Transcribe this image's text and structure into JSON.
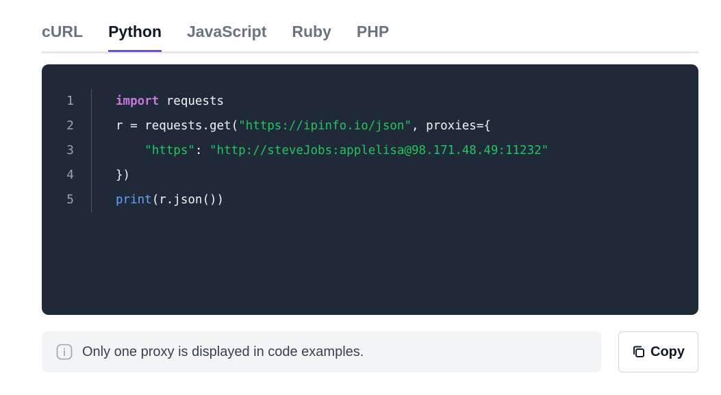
{
  "tabs": [
    {
      "label": "cURL",
      "active": false
    },
    {
      "label": "Python",
      "active": true
    },
    {
      "label": "JavaScript",
      "active": false
    },
    {
      "label": "Ruby",
      "active": false
    },
    {
      "label": "PHP",
      "active": false
    }
  ],
  "code": {
    "line_numbers": [
      "1",
      "2",
      "3",
      "4",
      "5"
    ],
    "lines": {
      "l1_keyword": "import",
      "l1_rest": " requests",
      "l2_prefix": "r = requests.get(",
      "l2_url": "\"https://ipinfo.io/json\"",
      "l2_suffix": ", proxies={",
      "l3_indent": "    ",
      "l3_key": "\"https\"",
      "l3_colon": ": ",
      "l3_value": "\"http://steveJobs:applelisa@98.171.48.49:11232\"",
      "l4": "})",
      "l5_fn": "print",
      "l5_rest": "(r.json())"
    },
    "colors": {
      "background": "#1f2937",
      "keyword": "#c678dd",
      "string": "#22c55e",
      "function": "#60a5fa"
    }
  },
  "notice": {
    "icon": "info-icon",
    "text": "Only one proxy is displayed in code examples."
  },
  "copy_button": {
    "icon": "copy-icon",
    "label": "Copy"
  },
  "accent_color": "#6d4dd8"
}
